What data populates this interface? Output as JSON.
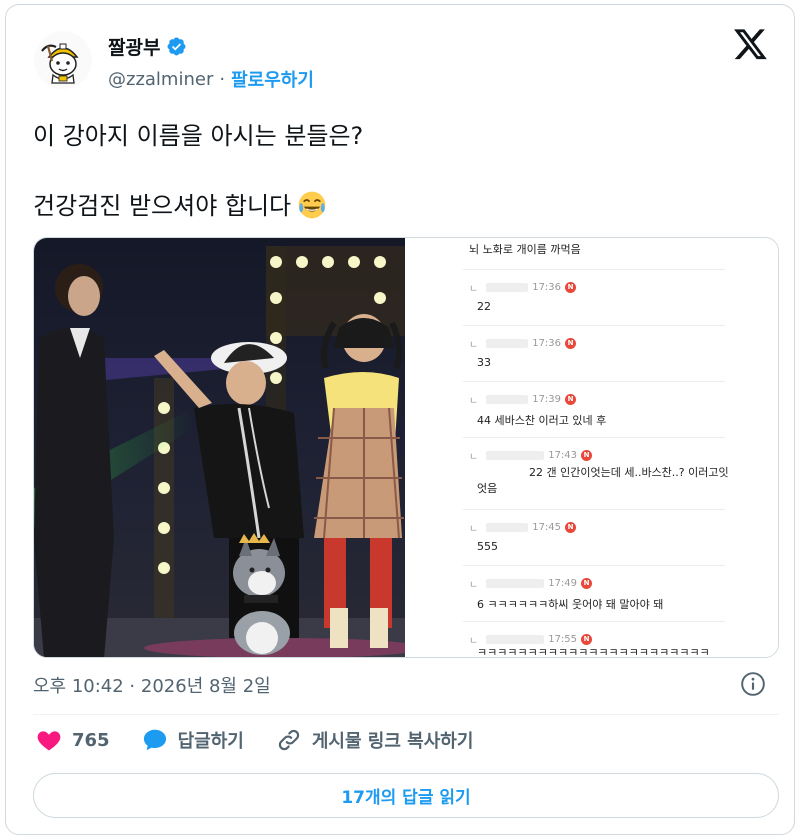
{
  "author": {
    "display_name": "짤광부",
    "handle": "@zzalminer",
    "separator": "·",
    "follow_label": "팔로우하기",
    "verified": true
  },
  "tweet": {
    "line1": "이 강아지 이름을 아시는 분들은?",
    "line2": "건강검진 받으셔야 합니다",
    "emoji": "face-with-tears-of-joy"
  },
  "media": {
    "comments": [
      {
        "time": "",
        "body": "뇌 노화로 개이름 까먹음"
      },
      {
        "time": "17:36",
        "body": "22"
      },
      {
        "time": "17:36",
        "body": "33"
      },
      {
        "time": "17:39",
        "body": "44 세바스찬 이러고 있네 후"
      },
      {
        "time": "17:43",
        "body": "22 갠 인간이엇는데 세..바스찬..? 이러고잇",
        "body2": "엇음"
      },
      {
        "time": "17:45",
        "body": "555"
      },
      {
        "time": "17:49",
        "body": "6 ㅋㅋㅋㅋㅋㅋ하씨 웃어야 돼 말아야 돼"
      },
      {
        "time": "17:55",
        "body": "ㅋㅋㅋㅋㅋㅋㅋㅋㅋㅋㅋㅋㅋㅋㅋㅋㅋㅋㅋㅋㅋㅋㅋ"
      }
    ],
    "badge_letter": "N",
    "reply_marker": "ㄴ"
  },
  "timestamp": "오후 10:42 · 2026년 8월 2일",
  "actions": {
    "like_count": "765",
    "reply_label": "답글하기",
    "copy_link_label": "게시물 링크 복사하기"
  },
  "read_replies_label": "17개의 답글 읽기",
  "colors": {
    "accent": "#1d9bf0",
    "like": "#f91880",
    "text": "#0f1419",
    "muted": "#536471",
    "border": "#cfd9de"
  }
}
